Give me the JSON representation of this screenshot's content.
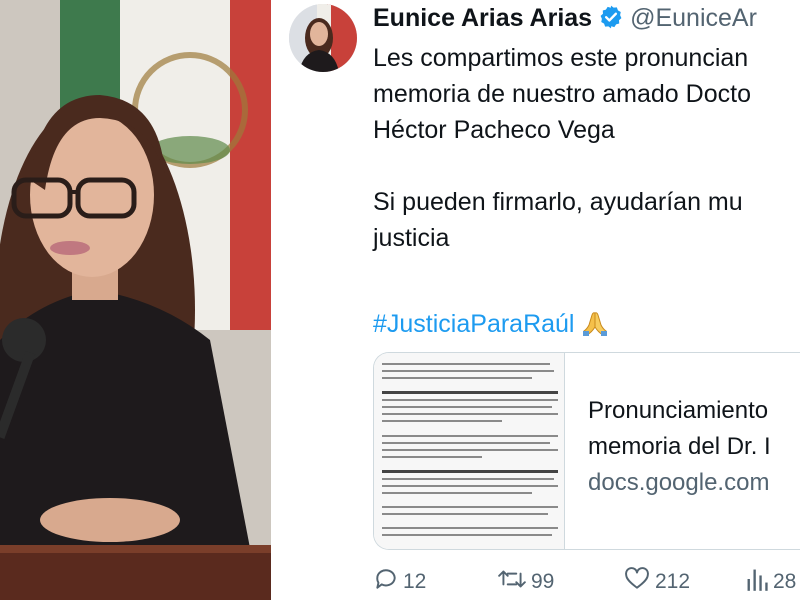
{
  "tweet": {
    "display_name": "Eunice Arias Arias",
    "handle": "@EuniceAr",
    "lines": [
      "Les compartimos este pronuncian",
      "memoria de nuestro amado Docto",
      "Héctor Pacheco Vega",
      "",
      "Si pueden firmarlo, ayudarían mu",
      "justicia"
    ],
    "hashtag": "#JusticiaParaRaúl",
    "emoji": "🙏"
  },
  "card": {
    "title_lines": [
      "Pronunciamiento",
      "memoria del Dr. I"
    ],
    "domain": "docs.google.com"
  },
  "metrics": {
    "replies": "12",
    "reposts": "99",
    "likes": "212",
    "views": "28"
  },
  "colors": {
    "link": "#1d9bf0",
    "secondary": "#536471",
    "verified": "#1d9bf0"
  },
  "icons": [
    "verified-badge-icon",
    "reply-icon",
    "repost-icon",
    "like-icon",
    "views-icon",
    "folded-hands-emoji"
  ]
}
